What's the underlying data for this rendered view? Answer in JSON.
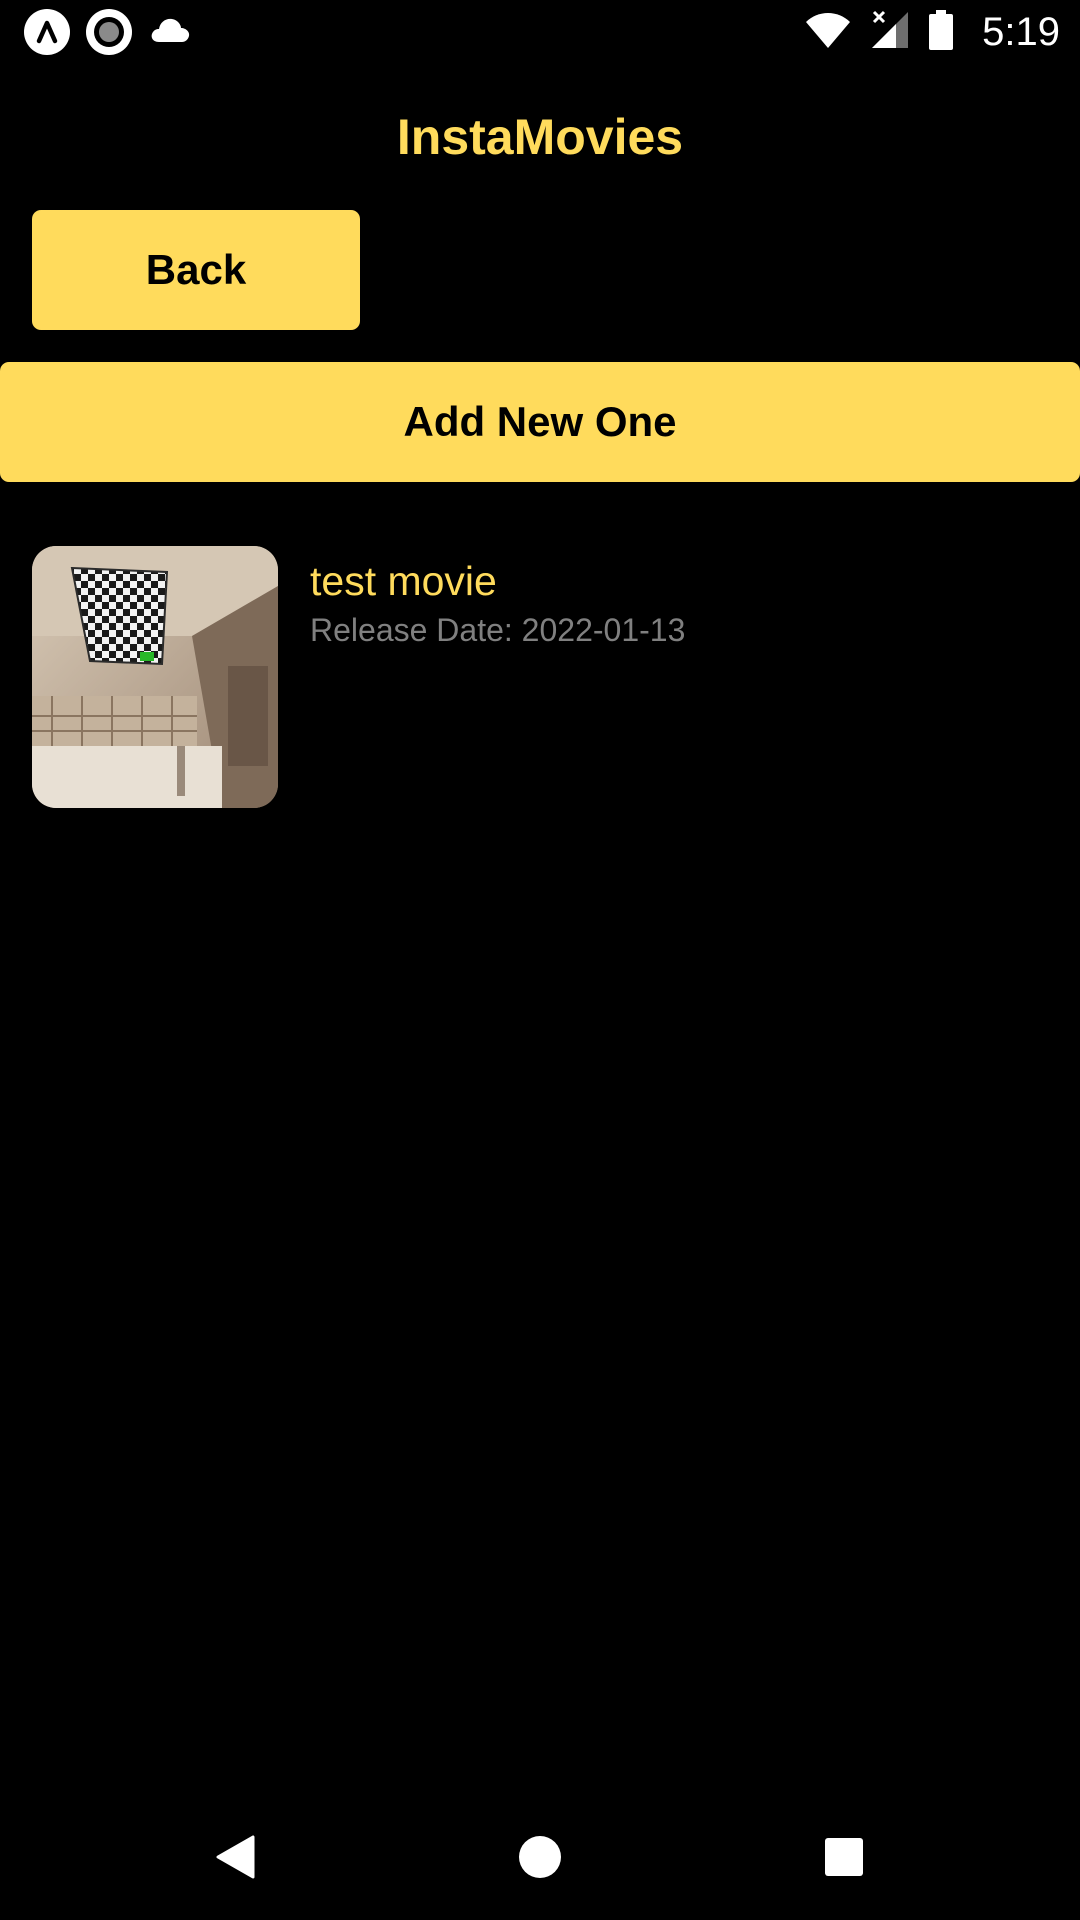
{
  "status_bar": {
    "time": "5:19",
    "left_icons": [
      "app-launcher-icon",
      "record-icon",
      "cloud-icon"
    ],
    "right_icons": [
      "wifi-icon",
      "signal-icon",
      "battery-icon"
    ]
  },
  "header": {
    "title": "InstaMovies"
  },
  "actions": {
    "back_label": "Back",
    "add_label": "Add New One"
  },
  "movies": [
    {
      "title": "test movie",
      "release_date": "Release Date: 2022-01-13"
    }
  ],
  "nav_bar": {
    "icons": [
      "back-nav-icon",
      "home-nav-icon",
      "recents-nav-icon"
    ]
  },
  "colors": {
    "accent": "#FFDB5C",
    "background": "#000000",
    "secondary_text": "#808080"
  }
}
